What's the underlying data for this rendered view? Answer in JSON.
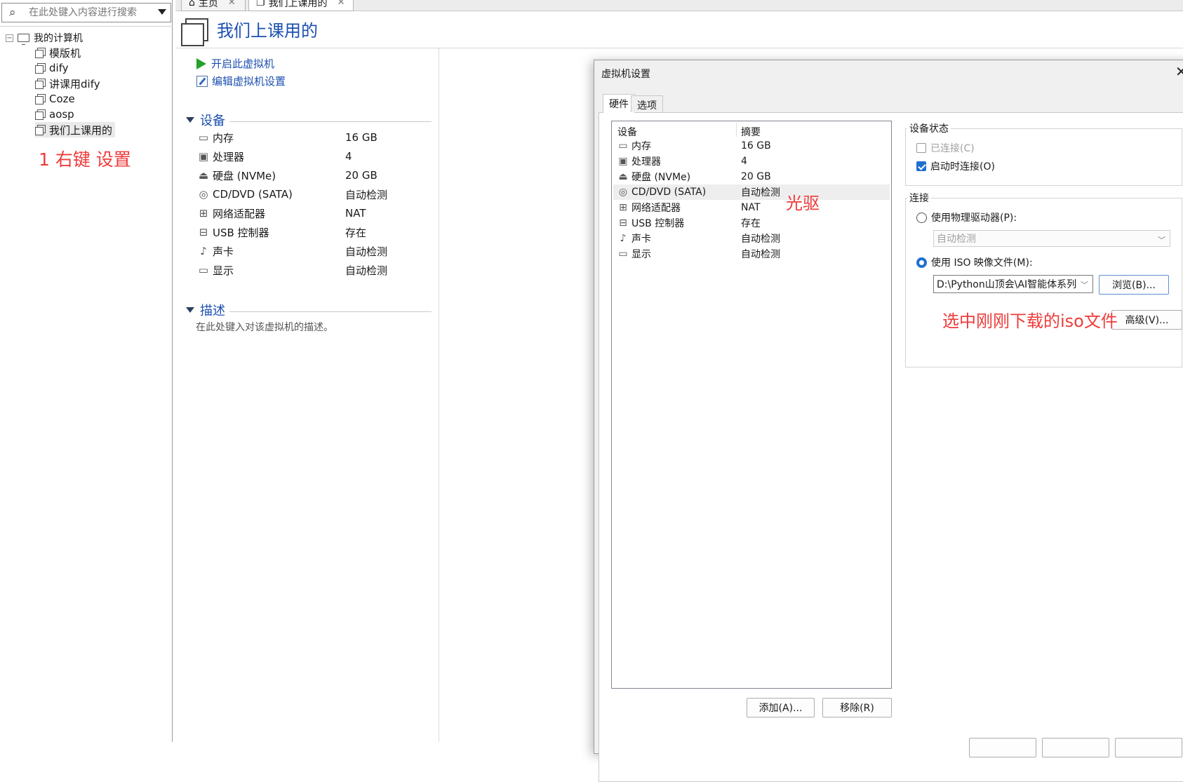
{
  "search": {
    "placeholder": "在此处键入内容进行搜索"
  },
  "tree": {
    "root_label": "我的计算机",
    "items": [
      {
        "label": "模版机"
      },
      {
        "label": "dify"
      },
      {
        "label": "讲课用dify"
      },
      {
        "label": "Coze"
      },
      {
        "label": "aosp"
      },
      {
        "label": "我们上课用的"
      }
    ]
  },
  "annotations": {
    "right_click": "1 右键 设置",
    "optical": "光驱",
    "iso": "选中刚刚下载的iso文件"
  },
  "tabs": [
    {
      "label": "主页"
    },
    {
      "label": "我们上课用的"
    }
  ],
  "vm": {
    "title": "我们上课用的",
    "actions": {
      "power_on": "开启此虚拟机",
      "edit_settings": "编辑虚拟机设置"
    },
    "devices_section": "设备",
    "devices": [
      {
        "name": "内存",
        "value": "16 GB",
        "icon": "memory-icon"
      },
      {
        "name": "处理器",
        "value": "4",
        "icon": "cpu-icon"
      },
      {
        "name": "硬盘 (NVMe)",
        "value": "20 GB",
        "icon": "disk-icon"
      },
      {
        "name": "CD/DVD (SATA)",
        "value": "自动检测",
        "icon": "cd-icon"
      },
      {
        "name": "网络适配器",
        "value": "NAT",
        "icon": "network-icon"
      },
      {
        "name": "USB 控制器",
        "value": "存在",
        "icon": "usb-icon"
      },
      {
        "name": "声卡",
        "value": "自动检测",
        "icon": "sound-icon"
      },
      {
        "name": "显示",
        "value": "自动检测",
        "icon": "display-icon"
      }
    ],
    "description_section": "描述",
    "description_placeholder": "在此处键入对该虚拟机的描述。"
  },
  "dialog": {
    "title": "虚拟机设置",
    "tabs": {
      "hardware": "硬件",
      "options": "选项"
    },
    "list_headers": {
      "device": "设备",
      "summary": "摘要"
    },
    "devices": [
      {
        "name": "内存",
        "value": "16 GB"
      },
      {
        "name": "处理器",
        "value": "4"
      },
      {
        "name": "硬盘 (NVMe)",
        "value": "20 GB"
      },
      {
        "name": "CD/DVD (SATA)",
        "value": "自动检测"
      },
      {
        "name": "网络适配器",
        "value": "NAT"
      },
      {
        "name": "USB 控制器",
        "value": "存在"
      },
      {
        "name": "声卡",
        "value": "自动检测"
      },
      {
        "name": "显示",
        "value": "自动检测"
      }
    ],
    "selected_device": "CD/DVD (SATA)",
    "add_button": "添加(A)...",
    "remove_button": "移除(R)",
    "device_status": {
      "title": "设备状态",
      "connected": "已连接(C)",
      "connect_at_power_on": "启动时连接(O)"
    },
    "connection": {
      "title": "连接",
      "physical_drive": "使用物理驱动器(P):",
      "physical_drive_value": "自动检测",
      "iso_image": "使用 ISO 映像文件(M):",
      "iso_path": "D:\\Python山顶会\\AI智能体系列",
      "browse": "浏览(B)...",
      "advanced": "高级(V)..."
    }
  },
  "colors": {
    "link_blue": "#1c4fb0",
    "annotation_red": "#ee3b3b",
    "checkbox_blue": "#1f6fd0"
  }
}
